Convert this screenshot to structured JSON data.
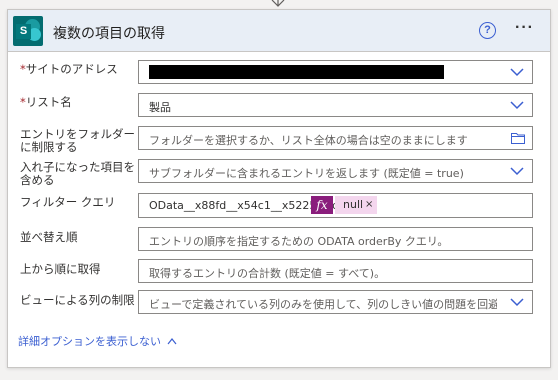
{
  "header": {
    "title": "複数の項目の取得",
    "help_label": "?",
    "more_label": "···",
    "logo_letter": "S"
  },
  "fields": {
    "site_address": {
      "label": "サイトのアドレス",
      "required_mark": "*"
    },
    "list_name": {
      "label": "リスト名",
      "required_mark": "*",
      "value": "製品"
    },
    "limit_folder": {
      "label_line1": "エントリをフォルダー",
      "label_line2": "に制限する",
      "placeholder": "フォルダーを選択するか、リスト全体の場合は空のままにします"
    },
    "nested_items": {
      "label_line1": "入れ子になった項目を",
      "label_line2": "含める",
      "placeholder": "サブフォルダーに含まれるエントリを返します (既定値 = true)"
    },
    "filter_query": {
      "label": "フィルター クエリ",
      "value": "OData__x88fd__x54c1__x5225_ eq",
      "fx_label": "fx",
      "token_label": "null",
      "token_close": "×"
    },
    "order_by": {
      "label": "並べ替え順",
      "placeholder": "エントリの順序を指定するための ODATA orderBy クエリ。"
    },
    "top_count": {
      "label": "上から順に取得",
      "placeholder": "取得するエントリの合計数 (既定値 = すべて)。"
    },
    "column_limit": {
      "label": "ビューによる列の制限",
      "placeholder": "ビューで定義されている列のみを使用して、列のしきい値の問題を回避"
    }
  },
  "advanced_toggle": "詳細オプションを表示しない",
  "colors": {
    "header_bg": "#e8eef6",
    "sharepoint_teal": "#036c70",
    "link_blue": "#3b5fd1",
    "fx_purple": "#8a1d7c",
    "token_pink": "#f4d6ee",
    "required_red": "#a4262c"
  }
}
